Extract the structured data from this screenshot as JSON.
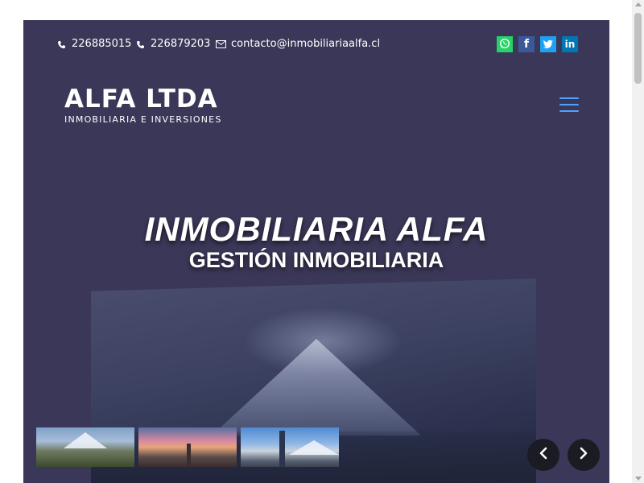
{
  "topbar": {
    "phone1": "226885015",
    "phone2": "226879203",
    "email": "contacto@inmobiliariaalfa.cl",
    "social": [
      {
        "name": "whatsapp",
        "color": "#25d366"
      },
      {
        "name": "facebook",
        "color": "#3b5998"
      },
      {
        "name": "twitter",
        "color": "#1da1f2"
      },
      {
        "name": "linkedin",
        "color": "#0077b5"
      }
    ]
  },
  "logo": {
    "title": "ALFA LTDA",
    "subtitle": "INMOBILIARIA E INVERSIONES"
  },
  "hero": {
    "title": "INMOBILIARIA ALFA",
    "subtitle": "GESTIÓN INMOBILIARIA"
  },
  "colors": {
    "background": "#3b3758",
    "hamburger": "#4aa3ff",
    "nav_button": "#1b1b24"
  },
  "icons": {
    "phone": "phone-icon",
    "email": "envelope-icon",
    "menu": "hamburger-menu-icon",
    "prev": "chevron-left-icon",
    "next": "chevron-right-icon"
  }
}
